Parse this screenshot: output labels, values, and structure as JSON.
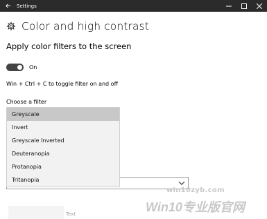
{
  "window": {
    "title": "Settings"
  },
  "page": {
    "title": "Color and high contrast"
  },
  "section": {
    "title": "Apply color filters to the screen"
  },
  "toggle": {
    "state": "On",
    "is_on": true
  },
  "hint": {
    "text": "Win + Ctrl + C to toggle filter on and off"
  },
  "filter": {
    "label": "Choose a filter",
    "selected": "Greyscale",
    "options": [
      "Greyscale",
      "Invert",
      "Greyscale Inverted",
      "Deuteranopia",
      "Protanopia",
      "Tritanopia"
    ]
  },
  "bottom": {
    "text": "Text"
  },
  "watermark": {
    "url": "win10zyb.com",
    "brand": "Win10专业版官网"
  },
  "icons": {
    "back": "back-arrow-icon",
    "gear": "gear-icon",
    "minimize": "minimize-icon",
    "maximize": "maximize-icon",
    "close": "close-icon",
    "chevron": "chevron-down-icon"
  }
}
